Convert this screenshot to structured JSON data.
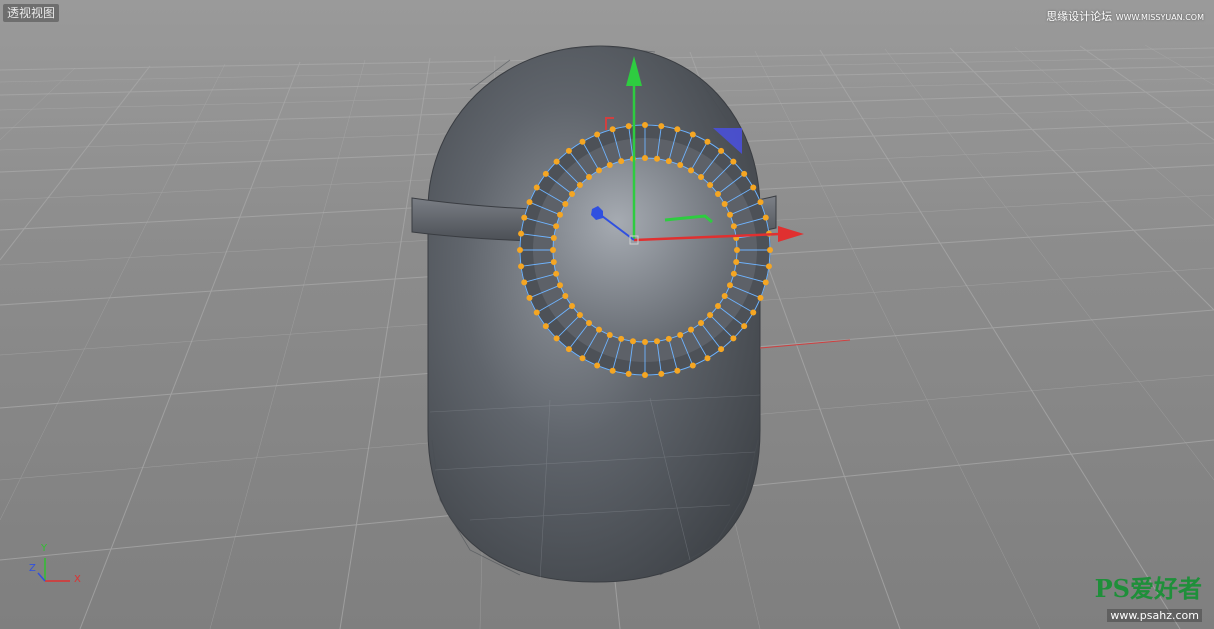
{
  "viewport": {
    "label": "透视视图",
    "background": "#8c8c8c"
  },
  "watermark_top": {
    "site_cn": "思缘设计论坛",
    "site_url": "WWW.MISSYUAN.COM"
  },
  "watermark_bottom": {
    "logo_latin": "PS",
    "logo_cn": "爱好者",
    "url": "www.psahz.com"
  },
  "axis_indicator": {
    "x": "X",
    "y": "Y",
    "z": "Z",
    "colors": {
      "x": "#e03030",
      "y": "#30c030",
      "z": "#3050e0"
    }
  },
  "colors": {
    "selection": "#f5a623",
    "mesh_edge": "#6fb4ff",
    "model": "#5a5f66"
  }
}
